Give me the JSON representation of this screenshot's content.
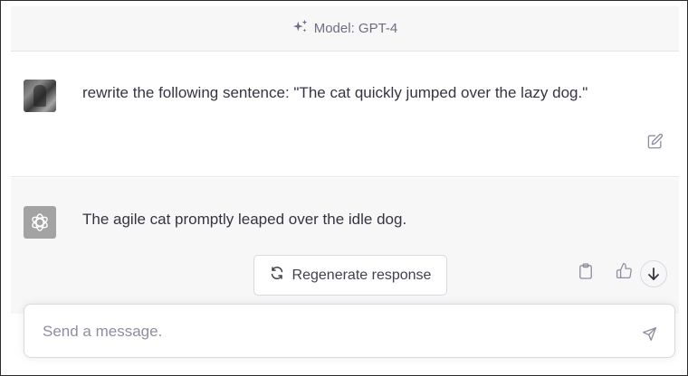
{
  "header": {
    "model_label": "Model: GPT-4",
    "icon": "sparkles-icon"
  },
  "conversation": {
    "user_message": {
      "avatar": "user-avatar",
      "text": "rewrite the following sentence: \"The cat quickly jumped over the lazy dog.\"",
      "actions": [
        "edit-icon"
      ]
    },
    "assistant_message": {
      "avatar": "openai-logo",
      "text": "The agile cat promptly leaped over the idle dog.",
      "actions": [
        "clipboard-icon",
        "thumbs-up-icon"
      ]
    }
  },
  "regenerate": {
    "label": "Regenerate response",
    "icon": "refresh-icon"
  },
  "composer": {
    "placeholder": "Send a message.",
    "value": "",
    "send_icon": "send-icon"
  },
  "colors": {
    "assistant_bg": "#f7f7f8",
    "text": "#343541",
    "muted": "#8e8ea0"
  }
}
